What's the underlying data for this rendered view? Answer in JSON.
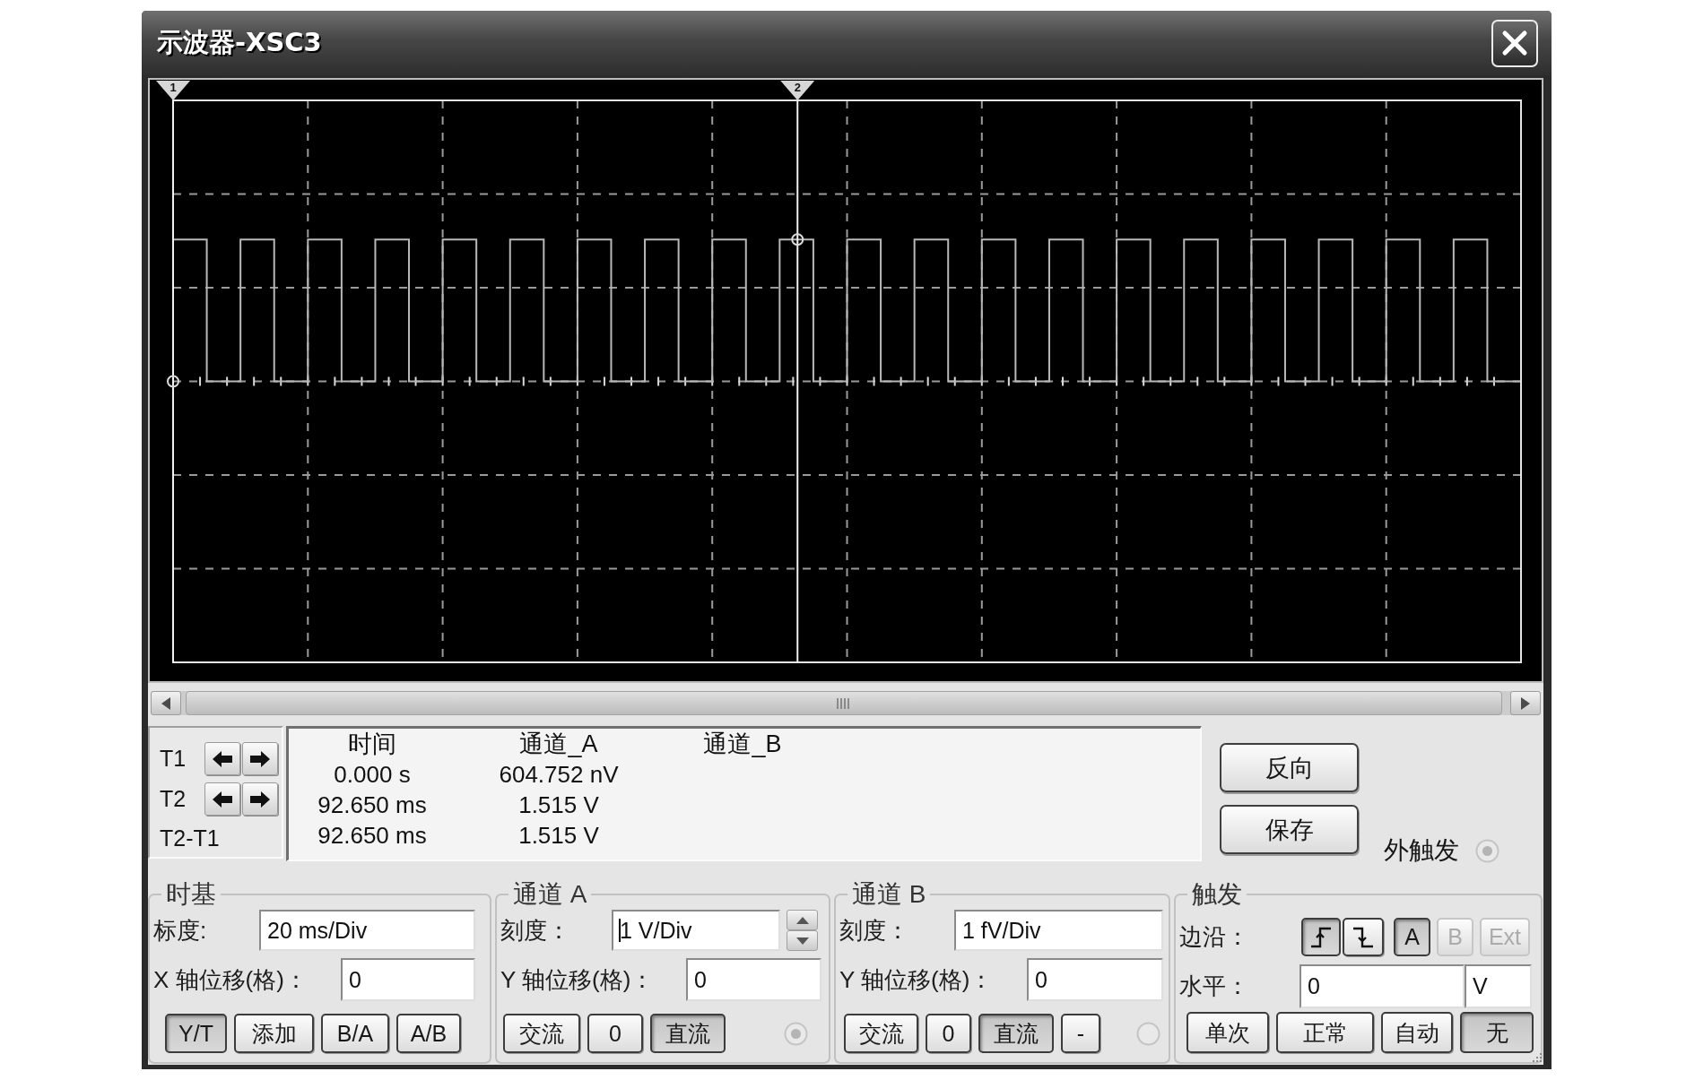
{
  "window": {
    "title": "示波器-XSC3"
  },
  "screen": {
    "cursors": [
      {
        "label": "1",
        "level": 0
      },
      {
        "label": "2",
        "level": 0.46325
      }
    ]
  },
  "cursor_controls": [
    {
      "label": "T1",
      "kind": "movable"
    },
    {
      "label": "T2",
      "kind": "movable"
    },
    {
      "label": "T2-T1",
      "kind": "difference"
    }
  ],
  "readout": {
    "columns": [
      "时间",
      "通道_A",
      "通道_B"
    ],
    "rows": [
      {
        "time": "0.000 s",
        "channel_a": "604.752 nV"
      },
      {
        "time": "92.650 ms",
        "channel_a": "1.515 V"
      },
      {
        "time": "92.650 ms",
        "channel_a": "1.515 V"
      }
    ]
  },
  "actions": [
    "反向",
    "保存"
  ],
  "ext_trigger": {
    "label": "外触发",
    "connected": true
  },
  "timebase": {
    "title": "时基",
    "scale": {
      "label": "标度:",
      "value": "20 ms/Div"
    },
    "x_position": {
      "label": "X 轴位移(格)：",
      "value": "0"
    },
    "modes": [
      {
        "label": "Y/T",
        "selected": true
      },
      {
        "label": "添加",
        "selected": false
      },
      {
        "label": "B/A",
        "selected": false
      },
      {
        "label": "A/B",
        "selected": false
      }
    ]
  },
  "channel_a": {
    "title": "通道 A",
    "scale": {
      "label": "刻度：",
      "value": "1 V/Div",
      "focused": true
    },
    "y_position": {
      "label": "Y 轴位移(格)：",
      "value": "0"
    },
    "buttons": [
      {
        "label": "交流",
        "selected": false
      },
      {
        "label": "0",
        "selected": false
      },
      {
        "label": "直流",
        "selected": true
      }
    ],
    "connected": true
  },
  "channel_b": {
    "title": "通道 B",
    "scale": {
      "label": "刻度：",
      "value": "1 fV/Div",
      "focused": false
    },
    "y_position": {
      "label": "Y 轴位移(格)：",
      "value": "0"
    },
    "buttons": [
      {
        "label": "交流",
        "selected": false
      },
      {
        "label": "0",
        "selected": false
      },
      {
        "label": "直流",
        "selected": true
      },
      {
        "label": "-",
        "selected": false
      }
    ],
    "connected": false
  },
  "trigger": {
    "title": "触发",
    "edge_label": "边沿：",
    "edges": [
      {
        "kind": "rising",
        "selected": true
      },
      {
        "kind": "falling",
        "selected": false
      }
    ],
    "sources": [
      {
        "label": "A",
        "selected": true,
        "disabled": false
      },
      {
        "label": "B",
        "selected": false,
        "disabled": true
      },
      {
        "label": "Ext",
        "selected": false,
        "disabled": true
      }
    ],
    "threshold": {
      "label": "水平：",
      "value": "0",
      "unit": "V"
    },
    "modes": [
      {
        "label": "单次",
        "selected": false
      },
      {
        "label": "正常",
        "selected": false
      },
      {
        "label": "自动",
        "selected": false
      },
      {
        "label": "无",
        "selected": true
      }
    ]
  }
}
